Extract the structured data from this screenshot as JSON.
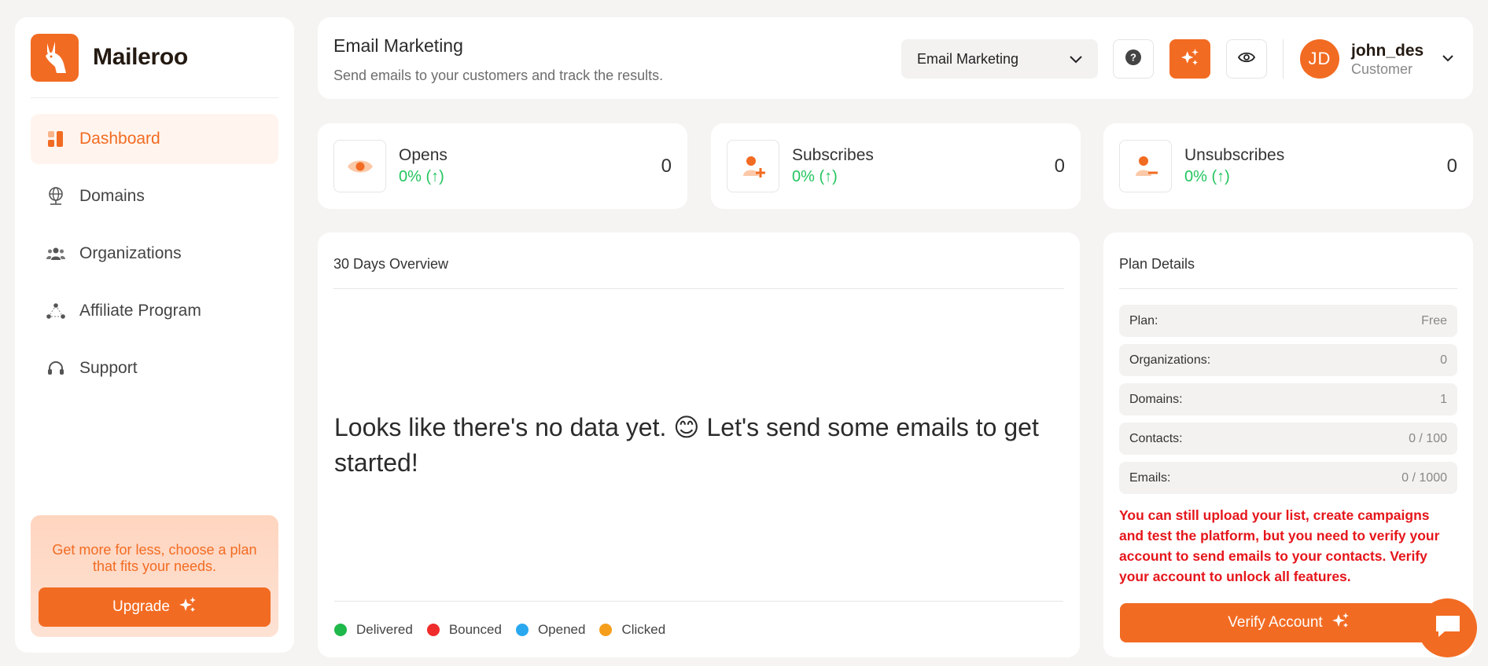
{
  "brand": {
    "name": "Maileroo"
  },
  "sidebar": {
    "items": [
      {
        "label": "Dashboard",
        "icon": "dashboard-icon",
        "active": true
      },
      {
        "label": "Domains",
        "icon": "globe-icon"
      },
      {
        "label": "Organizations",
        "icon": "users-icon"
      },
      {
        "label": "Affiliate Program",
        "icon": "share-icon"
      },
      {
        "label": "Support",
        "icon": "headset-icon"
      }
    ],
    "promo": {
      "text": "Get more for less, choose a plan that fits your needs.",
      "button": "Upgrade"
    }
  },
  "header": {
    "title": "Email Marketing",
    "subtitle": "Send emails to your customers and track the results.",
    "select_value": "Email Marketing",
    "user": {
      "initials": "JD",
      "name": "john_des",
      "role": "Customer"
    }
  },
  "stats": [
    {
      "label": "Opens",
      "pct": "0% (↑)",
      "value": "0",
      "icon": "eye-icon"
    },
    {
      "label": "Subscribes",
      "pct": "0% (↑)",
      "value": "0",
      "icon": "user-plus-icon"
    },
    {
      "label": "Unsubscribes",
      "pct": "0% (↑)",
      "value": "0",
      "icon": "user-minus-icon"
    }
  ],
  "overview": {
    "title": "30 Days Overview",
    "empty_message": "Looks like there's no data yet. 😊 Let's send some emails to get started!",
    "legend": [
      {
        "label": "Delivered",
        "color": "#1fb84a"
      },
      {
        "label": "Bounced",
        "color": "#ef2b2b"
      },
      {
        "label": "Opened",
        "color": "#29a8f0"
      },
      {
        "label": "Clicked",
        "color": "#f59e1b"
      }
    ]
  },
  "plan": {
    "title": "Plan Details",
    "rows": [
      {
        "label": "Plan:",
        "value": "Free"
      },
      {
        "label": "Organizations:",
        "value": "0"
      },
      {
        "label": "Domains:",
        "value": "1"
      },
      {
        "label": "Contacts:",
        "value": "0 / 100"
      },
      {
        "label": "Emails:",
        "value": "0 / 1000"
      }
    ],
    "warning": "You can still upload your list, create campaigns and test the platform, but you need to verify your account to send emails to your contacts. Verify your account to unlock all features.",
    "verify_button": "Verify Account"
  },
  "colors": {
    "accent": "#f26b22",
    "success": "#22c55e",
    "danger": "#e5161b"
  }
}
